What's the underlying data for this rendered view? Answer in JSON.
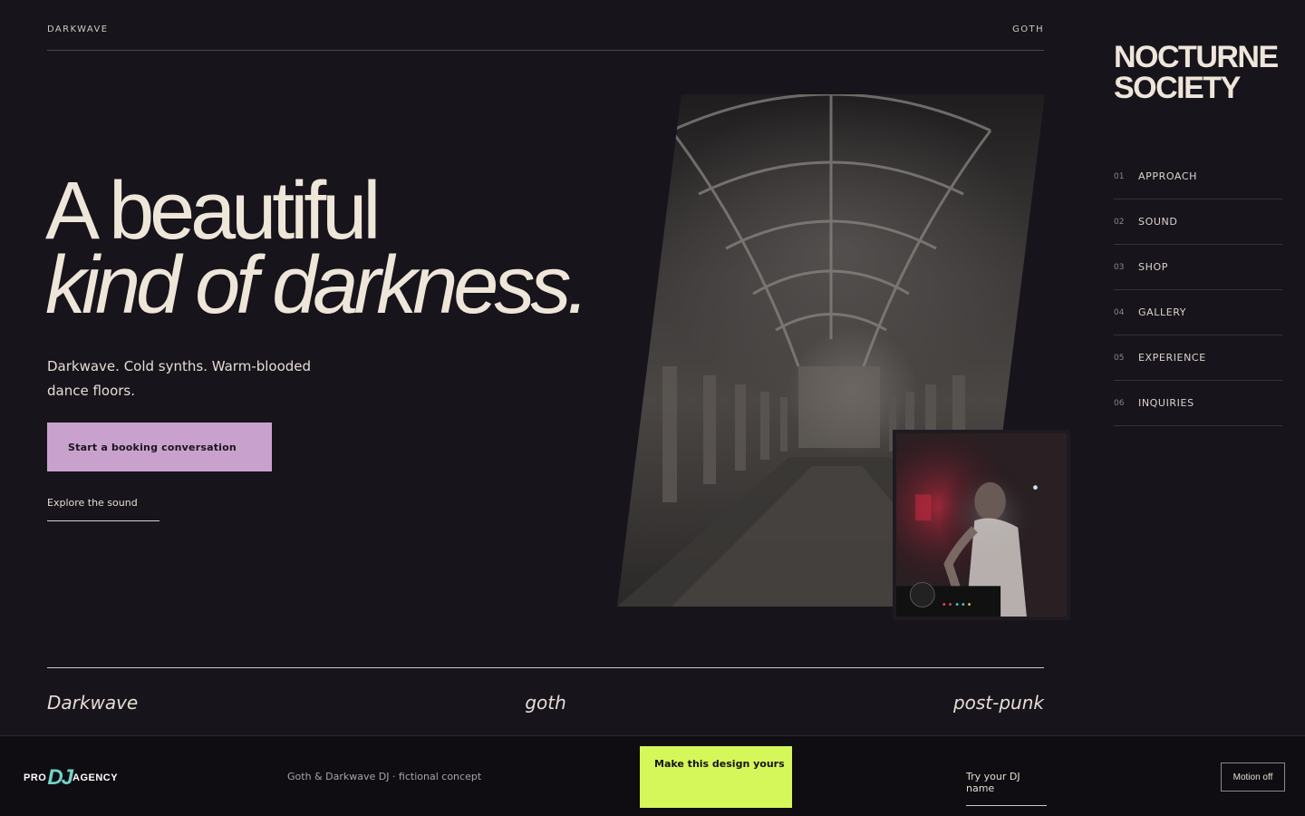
{
  "topbar": {
    "left": "DARKWAVE",
    "right": "GOTH"
  },
  "hero": {
    "headline_line1": "A beautiful",
    "headline_line2": "kind of darkness.",
    "subcopy": "Darkwave. Cold synths. Warm-blooded dance floors.",
    "cta_label": "Start a booking conversation",
    "explore_label": "Explore the sound"
  },
  "genres": [
    "Darkwave",
    "goth",
    "post-punk"
  ],
  "brand": {
    "line1": "NOCTURNE",
    "line2": "SOCIETY"
  },
  "nav": [
    {
      "num": "01",
      "label": "APPROACH"
    },
    {
      "num": "02",
      "label": "SOUND"
    },
    {
      "num": "03",
      "label": "SHOP"
    },
    {
      "num": "04",
      "label": "GALLERY"
    },
    {
      "num": "05",
      "label": "EXPERIENCE"
    },
    {
      "num": "06",
      "label": "INQUIRIES"
    }
  ],
  "footer": {
    "logo": {
      "pre": "PRO",
      "mid": "DJ",
      "post": "AGENCY"
    },
    "concept": "Goth & Darkwave DJ · fictional concept",
    "make_label": "Make this design yours",
    "try_label": "Try your DJ name",
    "motion_label": "Motion off"
  },
  "colors": {
    "background": "#17141c",
    "cta": "#c8a2cc",
    "footer_cta": "#d6f75a",
    "text": "#ece4da"
  }
}
